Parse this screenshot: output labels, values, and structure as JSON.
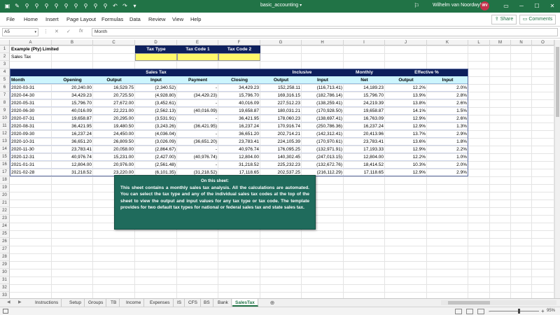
{
  "window": {
    "doc_title": "basic_accounting",
    "user_name": "Wilhelm van Noordwyk",
    "user_initials": "WV"
  },
  "ribbon": {
    "tabs": [
      "File",
      "Home",
      "Insert",
      "Page Layout",
      "Formulas",
      "Data",
      "Review",
      "View",
      "Help"
    ],
    "share_label": "Share",
    "comments_label": "Comments"
  },
  "formula_bar": {
    "name_box": "A5",
    "fx": "fx",
    "content": "Month"
  },
  "columns": [
    "A",
    "B",
    "C",
    "D",
    "E",
    "F",
    "G",
    "H",
    "I",
    "J",
    "K",
    "L",
    "M",
    "N",
    "O"
  ],
  "rows": [
    "1",
    "2",
    "3",
    "4",
    "5",
    "6",
    "7",
    "8",
    "9",
    "10",
    "11",
    "12",
    "13",
    "14",
    "15",
    "16",
    "17",
    "18",
    "19",
    "20",
    "21",
    "22",
    "23",
    "24",
    "25",
    "26",
    "27",
    "28",
    "29",
    "30",
    "31",
    "32",
    "33"
  ],
  "sheet": {
    "company": "Example (Pty) Limited",
    "subtitle": "Sales Tax",
    "selector_headers": [
      "Tax Type",
      "Tax Code 1",
      "Tax Code 2"
    ],
    "group_headers": {
      "sales_tax": "Sales Tax",
      "inclusive": "Inclusive",
      "monthly": "Monthly",
      "effective": "Effective %"
    },
    "col_headers": [
      "Month",
      "Opening",
      "Output",
      "Input",
      "Payment",
      "Closing",
      "Output",
      "Input",
      "Net",
      "Output",
      "Input"
    ],
    "data": [
      [
        "2020-03-31",
        "20,240.00",
        "16,529.75",
        "(2,340.52)",
        "-",
        "34,429.23",
        "152,258.11",
        "(116,713.41)",
        "14,189.23",
        "12.2%",
        "2.0%"
      ],
      [
        "2020-04-30",
        "34,429.23",
        "20,725.50",
        "(4,928.80)",
        "(34,429.23)",
        "15,796.70",
        "169,316.15",
        "(182,786.14)",
        "15,796.70",
        "13.9%",
        "2.8%"
      ],
      [
        "2020-05-31",
        "15,796.70",
        "27,672.00",
        "(3,452.61)",
        "-",
        "40,016.09",
        "227,512.23",
        "(138,259.41)",
        "24,219.39",
        "13.8%",
        "2.6%"
      ],
      [
        "2020-06-30",
        "40,016.09",
        "22,221.00",
        "(2,562.13)",
        "(40,016.09)",
        "19,658.87",
        "180,031.21",
        "(170,928.50)",
        "19,658.87",
        "14.1%",
        "1.5%"
      ],
      [
        "2020-07-31",
        "19,658.87",
        "20,295.00",
        "(3,531.91)",
        "-",
        "36,421.95",
        "178,060.23",
        "(138,697.41)",
        "16,763.09",
        "12.9%",
        "2.6%"
      ],
      [
        "2020-08-31",
        "36,421.95",
        "19,480.50",
        "(3,243.26)",
        "(36,421.95)",
        "16,237.24",
        "170,916.74",
        "(250,786.36)",
        "16,237.24",
        "12.9%",
        "1.3%"
      ],
      [
        "2020-09-30",
        "16,237.24",
        "24,450.00",
        "(4,036.04)",
        "-",
        "36,651.20",
        "202,714.21",
        "(142,312.41)",
        "20,413.96",
        "13.7%",
        "2.9%"
      ],
      [
        "2020-10-31",
        "36,651.20",
        "26,809.50",
        "(3,026.09)",
        "(36,651.20)",
        "23,783.41",
        "224,105.39",
        "(170,970.61)",
        "23,783.41",
        "13.6%",
        "1.8%"
      ],
      [
        "2020-11-30",
        "23,783.41",
        "20,058.00",
        "(2,864.67)",
        "-",
        "40,976.74",
        "176,095.25",
        "(132,971.91)",
        "17,193.33",
        "12.9%",
        "2.2%"
      ],
      [
        "2020-12-31",
        "40,976.74",
        "15,231.00",
        "(2,427.00)",
        "(40,976.74)",
        "12,804.00",
        "140,302.45",
        "(247,013.15)",
        "12,804.00",
        "12.2%",
        "1.0%"
      ],
      [
        "2021-01-31",
        "12,804.00",
        "20,976.00",
        "(2,561.48)",
        "-",
        "31,218.52",
        "225,232.23",
        "(132,672.76)",
        "18,414.52",
        "10.3%",
        "2.0%"
      ],
      [
        "2021-02-28",
        "31,218.52",
        "23,220.00",
        "(6,101.35)",
        "(31,218.52)",
        "17,118.65",
        "202,537.25",
        "(216,112.29)",
        "17,118.65",
        "12.9%",
        "2.9%"
      ]
    ]
  },
  "note": {
    "title": "On this sheet:",
    "body": "This sheet contains a monthly sales tax analysis. All the calculations are automated. You can select the tax type and any of the individual sales tax codes at the top of the sheet to view the output and input values for any tax type or tax code. The template provides for two default tax types for national or federal sales tax and state sales tax."
  },
  "sheet_tabs": [
    "Instructions",
    "Setup",
    "Groups",
    "TB",
    "Income",
    "Expenses",
    "IS",
    "CFS",
    "BS",
    "Bank",
    "SalesTax"
  ],
  "active_tab": "SalesTax",
  "status": {
    "zoom": "95%"
  },
  "colors": {
    "excel_green": "#217346",
    "header_navy": "#0d1f5c",
    "header_cyan": "#ccf5fd",
    "selector_yellow": "#fff86a",
    "note_green": "#1f6b5c"
  }
}
